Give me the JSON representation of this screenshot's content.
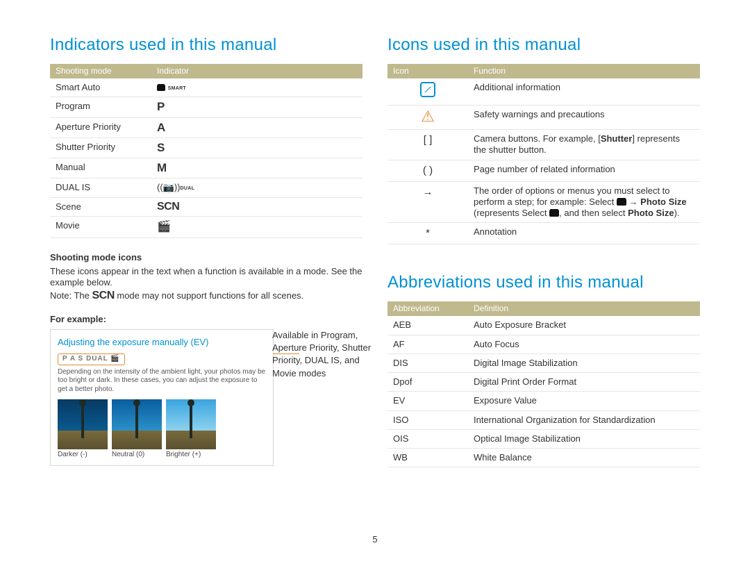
{
  "page_number": "5",
  "left": {
    "heading": "Indicators used in this manual",
    "table_headers": {
      "mode": "Shooting mode",
      "indicator": "Indicator"
    },
    "rows": [
      {
        "mode": "Smart Auto",
        "indicator_key": "smart",
        "indicator_label": "SMART"
      },
      {
        "mode": "Program",
        "indicator_key": "P",
        "indicator_label": "P"
      },
      {
        "mode": "Aperture Priority",
        "indicator_key": "A",
        "indicator_label": "A"
      },
      {
        "mode": "Shutter Priority",
        "indicator_key": "S",
        "indicator_label": "S"
      },
      {
        "mode": "Manual",
        "indicator_key": "M",
        "indicator_label": "M"
      },
      {
        "mode": "DUAL IS",
        "indicator_key": "dual",
        "indicator_label": "DUAL"
      },
      {
        "mode": "Scene",
        "indicator_key": "SCN",
        "indicator_label": "SCN"
      },
      {
        "mode": "Movie",
        "indicator_key": "movie",
        "indicator_label": "🎬"
      }
    ],
    "subhead_icons": "Shooting mode icons",
    "para1": "These icons appear in the text when a function is available in a mode. See the example below.",
    "note_prefix": "Note: The ",
    "note_mode": "SCN",
    "note_suffix": " mode may not support functions for all scenes.",
    "for_example": "For example:",
    "example": {
      "title": "Adjusting the exposure manually (EV)",
      "mode_strip": "P A S DUAL 🎬",
      "body": "Depending on the intensity of the ambient light, your photos may be too bright or dark. In these cases, you can adjust the exposure to get a better photo.",
      "thumbs": {
        "darker": "Darker (-)",
        "neutral": "Neutral (0)",
        "brighter": "Brighter (+)"
      },
      "callout": "Available in Program, Aperture Priority, Shutter Priority, DUAL IS, and Movie modes"
    }
  },
  "right": {
    "icons_heading": "Icons used in this manual",
    "icons_headers": {
      "icon": "Icon",
      "function": "Function"
    },
    "icons_rows": {
      "additional": "Additional information",
      "safety": "Safety warnings and precautions",
      "brackets_pre": "Camera buttons. For example, [",
      "brackets_bold": "Shutter",
      "brackets_post": "] represents the shutter button.",
      "parens": "Page number of related information",
      "arrow_pre": "The order of options or menus you must select to perform a step; for example: Select ",
      "arrow_mid_bold1": "Photo Size",
      "arrow_mid_plain": " (represents Select ",
      "arrow_mid_plain2": ", and then select ",
      "arrow_mid_bold2": "Photo Size",
      "arrow_post": ").",
      "asterisk": "Annotation"
    },
    "icon_glyphs": {
      "brackets": "[ ]",
      "parens": "( )",
      "arrow": "→",
      "asterisk": "*"
    },
    "abbr_heading": "Abbreviations used in this manual",
    "abbr_headers": {
      "abbr": "Abbreviation",
      "def": "Definition"
    },
    "abbr_rows": [
      {
        "abbr": "AEB",
        "def": "Auto Exposure Bracket"
      },
      {
        "abbr": "AF",
        "def": "Auto Focus"
      },
      {
        "abbr": "DIS",
        "def": "Digital Image Stabilization"
      },
      {
        "abbr": "Dpof",
        "def": "Digital Print Order Format"
      },
      {
        "abbr": "EV",
        "def": "Exposure Value"
      },
      {
        "abbr": "ISO",
        "def": "International Organization for Standardization"
      },
      {
        "abbr": "OIS",
        "def": "Optical Image Stabilization"
      },
      {
        "abbr": "WB",
        "def": "White Balance"
      }
    ]
  }
}
